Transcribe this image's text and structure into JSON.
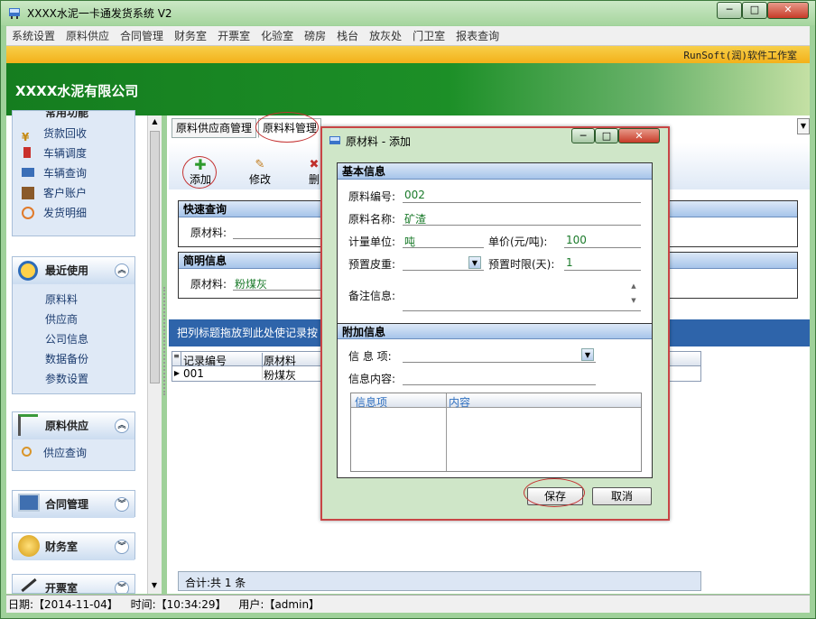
{
  "window": {
    "title": "XXXX水泥一卡通发货系统 V2",
    "min": "─",
    "max": "□",
    "close": "✕"
  },
  "menu": [
    "系统设置",
    "原料供应",
    "合同管理",
    "财务室",
    "开票室",
    "化验室",
    "磅房",
    "栈台",
    "放灰处",
    "门卫室",
    "报表查询"
  ],
  "brand": "RunSoft(润)软件工作室",
  "company": "XXXX水泥有限公司",
  "sidebar": {
    "top_header": "常用功能",
    "common_items": [
      "货款回收",
      "车辆调度",
      "车辆查询",
      "客户账户",
      "发货明细"
    ],
    "recent": {
      "title": "最近使用",
      "items": [
        "原料料",
        "供应商",
        "公司信息",
        "数据备份",
        "参数设置"
      ]
    },
    "supply": {
      "title": "原料供应",
      "items": [
        "供应查询"
      ]
    },
    "contract": {
      "title": "合同管理"
    },
    "finance": {
      "title": "财务室"
    },
    "billing": {
      "title": "开票室"
    }
  },
  "tabs": [
    "原料供应商管理",
    "原料料管理"
  ],
  "toolbar": {
    "add": "添加",
    "edit": "修改",
    "del": "删"
  },
  "quick": {
    "title": "快速查询",
    "label": "原材料:"
  },
  "brief": {
    "title": "简明信息",
    "label": "原材料:",
    "value": "粉煤灰"
  },
  "drag_hint": "把列标题拖放到此处使记录按",
  "grid": {
    "headers": [
      "记录编号",
      "原材料"
    ],
    "rows": [
      [
        "001",
        "粉煤灰"
      ]
    ]
  },
  "footer": "合计:共 1 条",
  "dialog": {
    "title": "原材料 - 添加",
    "basic": "基本信息",
    "code_lbl": "原料编号:",
    "code": "002",
    "name_lbl": "原料名称:",
    "name": "矿渣",
    "unit_lbl": "计量单位:",
    "unit": "吨",
    "price_lbl": "单价(元/吨):",
    "price": "100",
    "tare_lbl": "预置皮重:",
    "limit_lbl": "预置时限(天):",
    "limit": "1",
    "note_lbl": "备注信息:",
    "extra": "附加信息",
    "item_lbl": "信 息 项:",
    "content_lbl": "信息内容:",
    "col1": "信息项",
    "col2": "内容",
    "save": "保存",
    "cancel": "取消"
  },
  "status": {
    "date": "日期:【2014-11-04】",
    "time": "时间:【10:34:29】",
    "user": "用户:【admin】"
  }
}
